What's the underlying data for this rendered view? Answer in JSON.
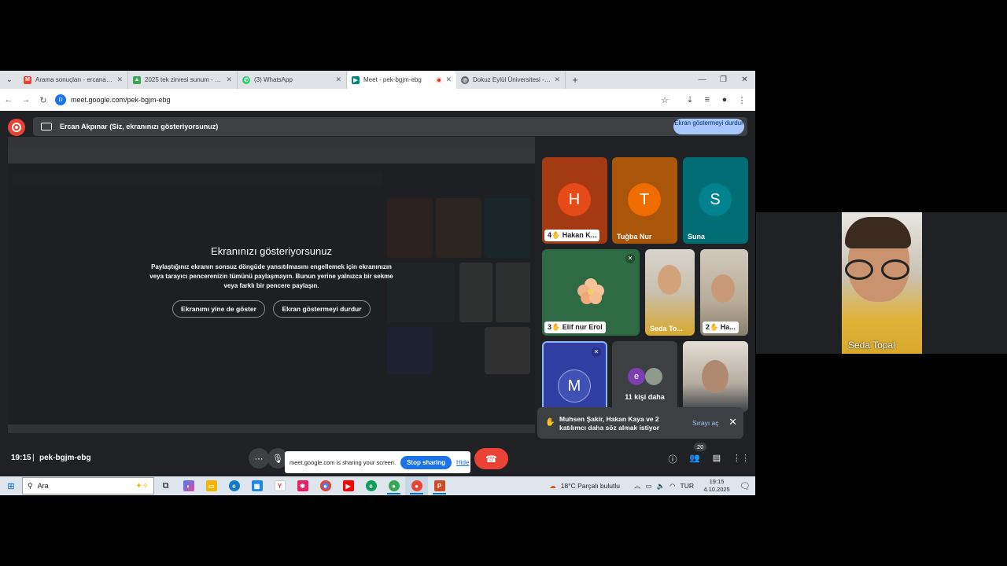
{
  "browser": {
    "tabs": [
      {
        "label": "Arama sonuçları - ercanakpina",
        "icon": "gmail-icon",
        "color": "#ea4335"
      },
      {
        "label": "2025 tek zirvesi sunum - Goog",
        "icon": "drive-icon",
        "color": "#34a853"
      },
      {
        "label": "(3) WhatsApp",
        "icon": "whatsapp-icon",
        "color": "#25d366"
      },
      {
        "label": "Meet - pek-bgjm-ebg",
        "icon": "meet-icon",
        "color": "#00897b"
      },
      {
        "label": "Dokuz Eylül Üniversitesi - Bilgi",
        "icon": "globe-icon",
        "color": "#5f6368"
      }
    ],
    "url": "meet.google.com/pek-bgjm-ebg"
  },
  "meet": {
    "presenter_text": "Ercan Akpınar (Siz, ekranınızı gösteriyorsunuz)",
    "stop_presenting_label": "Ekran göstermeyi durdur",
    "share_title": "Ekranınızı gösteriyorsunuz",
    "share_desc": "Paylaştığınız ekranın sonsuz döngüde yansıtılmasını engellemek için ekranınızın veya tarayıcı pencerenizin tümünü paylaşmayın. Bunun yerine yalnızca bir sekme veya farklı bir pencere paylaşın.",
    "show_anyway_label": "Ekranımı yine de göster",
    "stop_sharing_label": "Ekran göstermeyi durdur",
    "participants": [
      {
        "name": "4✋ Hakan K...",
        "initial": "H",
        "avatar_color": "#e64a19",
        "tile_color": "#a33a12"
      },
      {
        "name": "Tuğba Nur",
        "initial": "T",
        "avatar_color": "#ef6c00",
        "tile_color": "#a9560a"
      },
      {
        "name": "Suna",
        "initial": "S",
        "avatar_color": "#00838f",
        "tile_color": "#006d75"
      },
      {
        "name": "3✋ Elif nur Erol",
        "tile_color": "#2e6b45"
      },
      {
        "name": "Seda To...",
        "tile_color": "#cfc4b1"
      },
      {
        "name": "2✋ Ha...",
        "tile_color": "#bfb3a0"
      },
      {
        "name": "",
        "initial": "M",
        "avatar_color": "#3f51b5",
        "tile_color": "#2f3ea0"
      },
      {
        "name": "11 kişi daha",
        "initial": "e",
        "avatar_color": "#7b3fb0",
        "tile_color": "#3c4043"
      },
      {
        "name": "",
        "tile_color": "#c8c1b3"
      }
    ],
    "raise_hand_text": "Muhsen Şakir, Hakan Kaya ve 2 katılımcı daha söz almak istiyor",
    "queue_label": "Sırayı aç",
    "time": "19:15",
    "separator": "|",
    "meeting_code": "pek-bgjm-ebg",
    "people_count": "20",
    "sharing_notice": "meet.google.com is sharing your screen.",
    "stop_sharing_button": "Stop sharing",
    "hide_link": "Hide"
  },
  "taskbar": {
    "search_placeholder": "Ara",
    "weather": "18°C  Parçalı bulutlu",
    "lang": "TUR",
    "time": "19:15",
    "date": "4.10.2025"
  },
  "self_view": {
    "name": "Seda Topal"
  }
}
